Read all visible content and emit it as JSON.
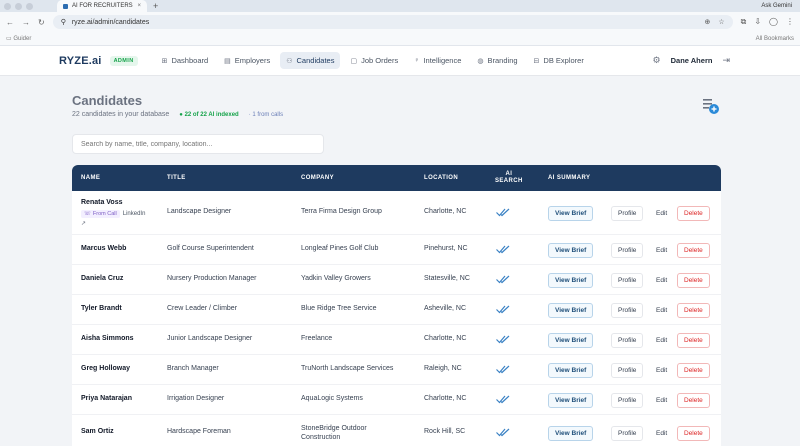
{
  "browser": {
    "tab_title": "AI FOR RECRUITERS",
    "url": "ryze.ai/admin/candidates",
    "bookmark_folder": "Guider",
    "all_bookmarks": "All Bookmarks",
    "gemini": "Ask Gemini"
  },
  "nav": {
    "logo": "RYZE.ai",
    "badge": "ADMIN",
    "items": [
      {
        "label": "Dashboard",
        "icon": "dashboard-icon",
        "active": false
      },
      {
        "label": "Employers",
        "icon": "building-icon",
        "active": false
      },
      {
        "label": "Candidates",
        "icon": "people-icon",
        "active": true
      },
      {
        "label": "Job Orders",
        "icon": "clipboard-icon",
        "active": false
      },
      {
        "label": "Intelligence",
        "icon": "bulb-icon",
        "active": false
      },
      {
        "label": "Branding",
        "icon": "palette-icon",
        "active": false
      },
      {
        "label": "DB Explorer",
        "icon": "database-icon",
        "active": false
      }
    ],
    "user": "Dane Ahern"
  },
  "page": {
    "title": "Candidates",
    "count_text": "22 candidates in your database",
    "ai_indexed": "22 of 22 AI indexed",
    "from_calls": "1 from calls",
    "search_placeholder": "Search by name, title, company, location..."
  },
  "table": {
    "headers": {
      "name": "NAME",
      "title": "TITLE",
      "company": "COMPANY",
      "location": "LOCATION",
      "ai_search_1": "AI",
      "ai_search_2": "SEARCH",
      "ai_summary": "AI SUMMARY"
    },
    "actions": {
      "view_brief": "View Brief",
      "profile": "Profile",
      "edit": "Edit",
      "delete": "Delete"
    },
    "from_call_label": "From Call",
    "linkedin_label": "LinkedIn",
    "rows": [
      {
        "name": "Renata Voss",
        "title": "Landscape Designer",
        "company": "Terra Firma Design Group",
        "location": "Charlotte, NC",
        "from_call": true
      },
      {
        "name": "Marcus Webb",
        "title": "Golf Course Superintendent",
        "company": "Longleaf Pines Golf Club",
        "location": "Pinehurst, NC"
      },
      {
        "name": "Daniela Cruz",
        "title": "Nursery Production Manager",
        "company": "Yadkin Valley Growers",
        "location": "Statesville, NC"
      },
      {
        "name": "Tyler Brandt",
        "title": "Crew Leader / Climber",
        "company": "Blue Ridge Tree Service",
        "location": "Asheville, NC"
      },
      {
        "name": "Aisha Simmons",
        "title": "Junior Landscape Designer",
        "company": "Freelance",
        "location": "Charlotte, NC"
      },
      {
        "name": "Greg Holloway",
        "title": "Branch Manager",
        "company": "TruNorth Landscape Services",
        "location": "Raleigh, NC"
      },
      {
        "name": "Priya Natarajan",
        "title": "Irrigation Designer",
        "company": "AquaLogic Systems",
        "location": "Charlotte, NC"
      },
      {
        "name": "Sam Ortiz",
        "title": "Hardscape Foreman",
        "company": "StoneBridge Outdoor",
        "company_2": "Construction",
        "location": "Rock Hill, SC"
      }
    ]
  },
  "colors": {
    "header_bg": "#1e3a5f",
    "accent_green": "#16a34a",
    "delete_red": "#dc2626",
    "check_blue": "#3b82c4"
  }
}
